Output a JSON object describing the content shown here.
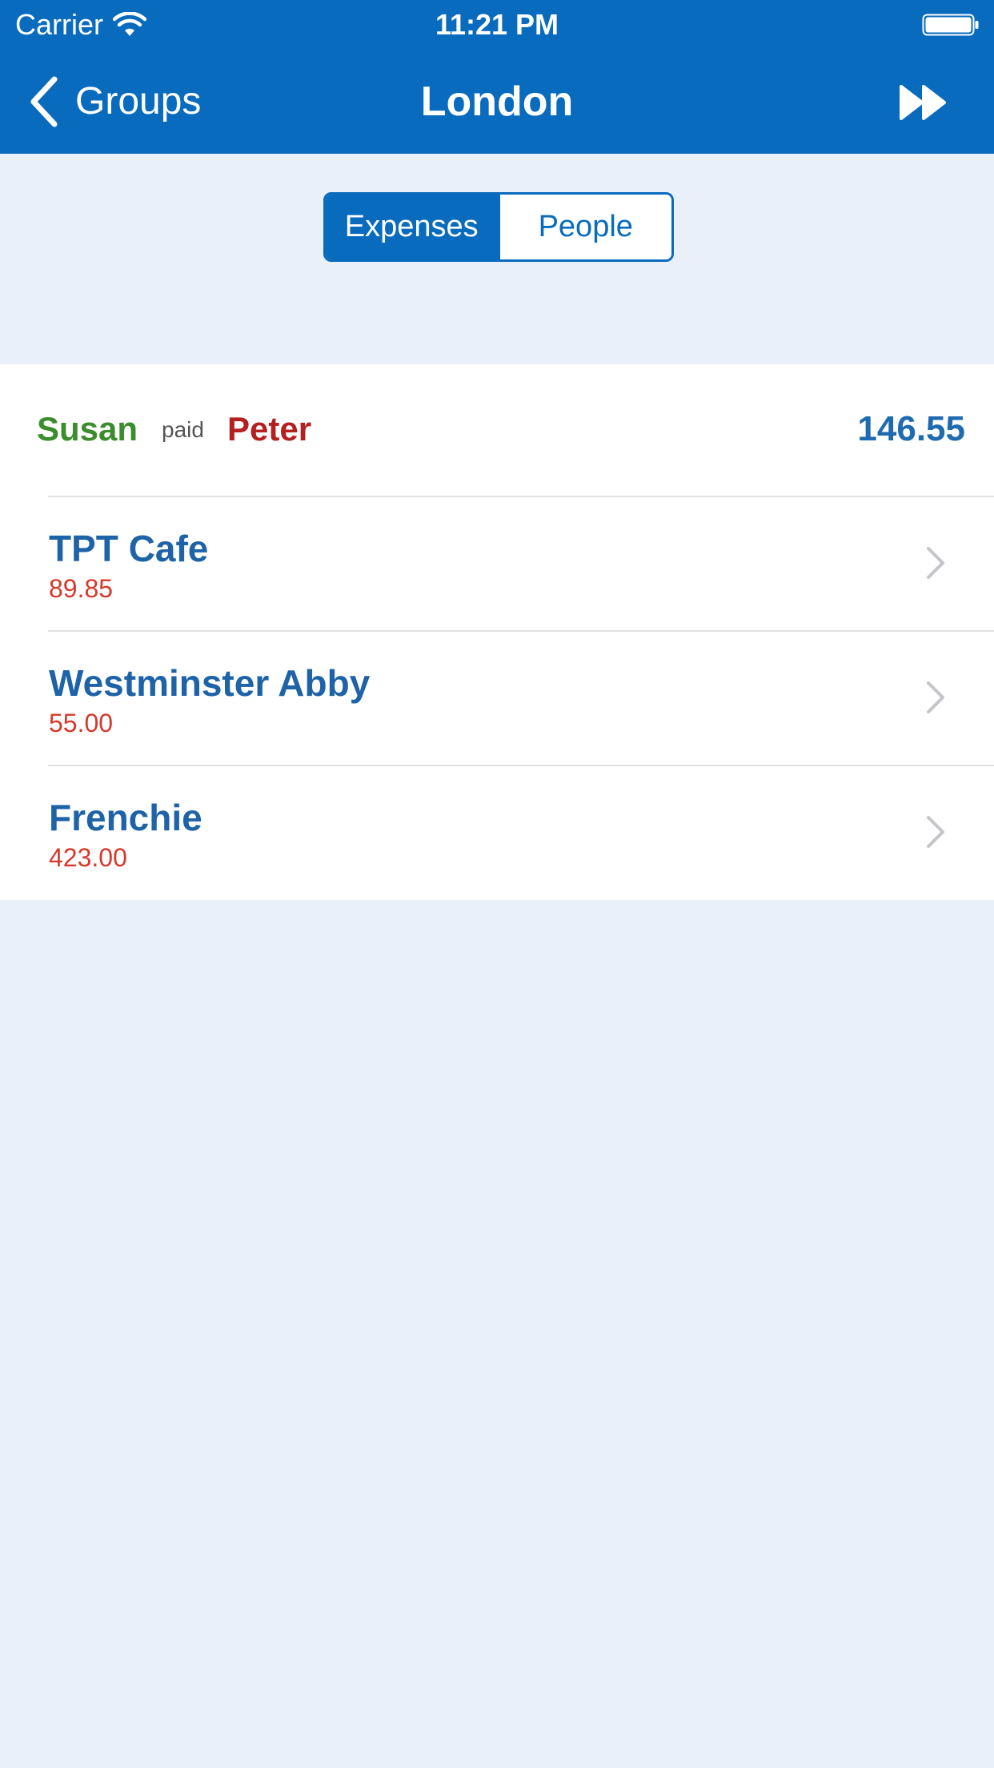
{
  "status_bar": {
    "carrier": "Carrier",
    "time": "11:21 PM",
    "wifi_icon": "wifi-icon",
    "battery_icon": "battery-icon"
  },
  "nav": {
    "back_label": "Groups",
    "back_icon": "chevron-left-icon",
    "title": "London",
    "forward_icon": "fast-forward-icon"
  },
  "segmented_control": {
    "segments": [
      "Expenses",
      "People"
    ],
    "selected": "Expenses"
  },
  "summary": {
    "payer": "Susan",
    "verb": "paid",
    "payee": "Peter",
    "amount": "146.55"
  },
  "expenses": [
    {
      "name": "TPT Cafe",
      "amount": "89.85"
    },
    {
      "name": "Westminster Abby",
      "amount": "55.00"
    },
    {
      "name": "Frenchie",
      "amount": "423.00"
    }
  ],
  "colors": {
    "header_blue": "#096bbd",
    "background": "#e9f0fa",
    "payer_green": "#3a8c2c",
    "payee_red": "#b41f1f",
    "amount_red": "#d6392c",
    "name_blue": "#1e63a8"
  }
}
